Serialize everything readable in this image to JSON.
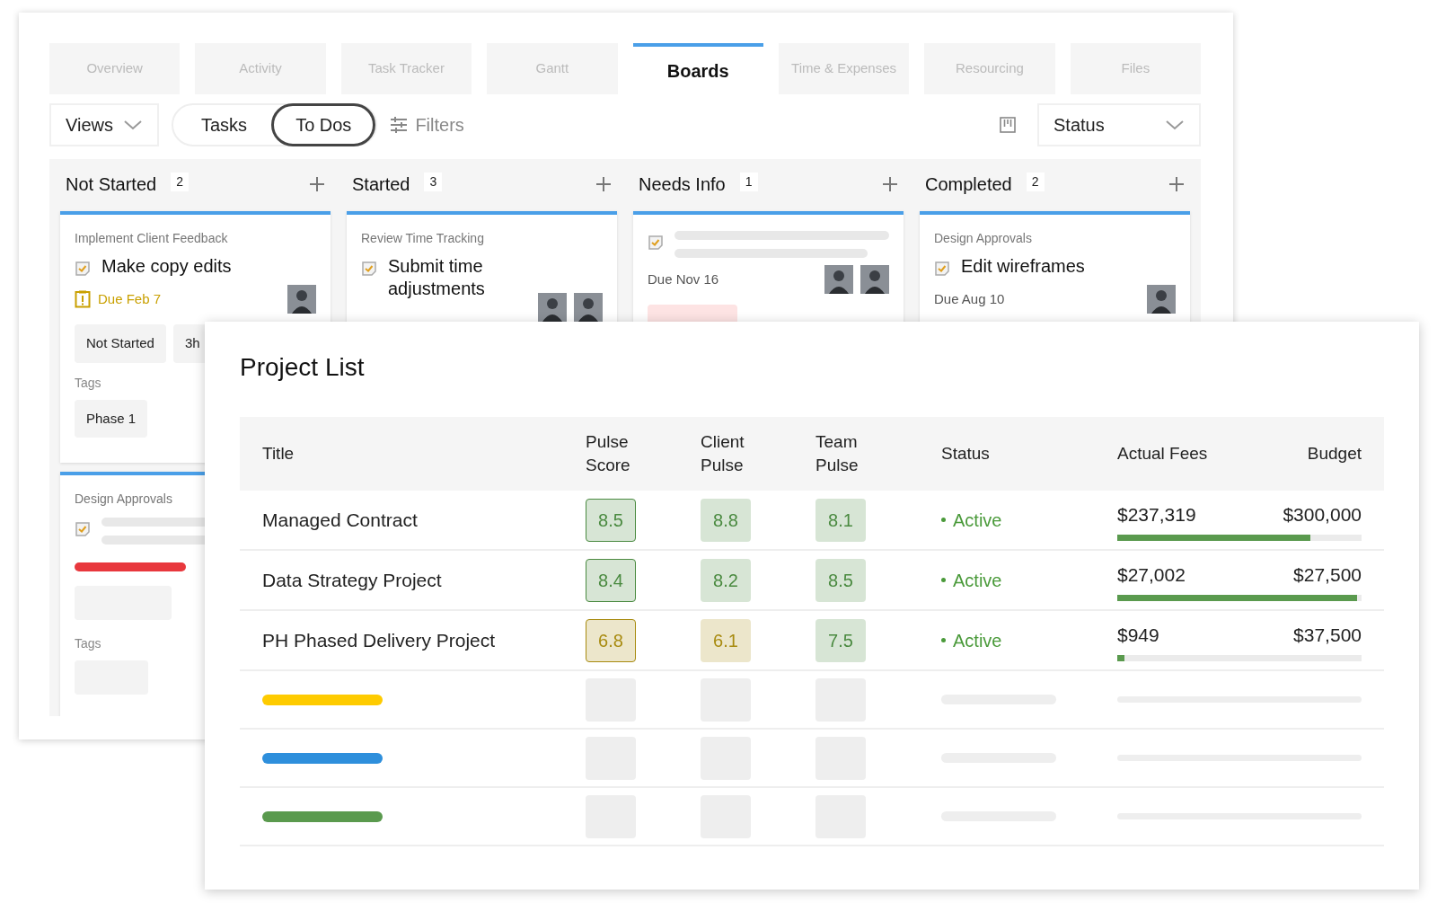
{
  "tabs": [
    {
      "label": "Overview",
      "selected": false
    },
    {
      "label": "Activity",
      "selected": false
    },
    {
      "label": "Task Tracker",
      "selected": false
    },
    {
      "label": "Gantt",
      "selected": false
    },
    {
      "label": "Boards",
      "selected": true
    },
    {
      "label": "Time & Expenses",
      "selected": false
    },
    {
      "label": "Resourcing",
      "selected": false
    },
    {
      "label": "Files",
      "selected": false
    }
  ],
  "toolbar": {
    "views": "Views",
    "segments": [
      {
        "label": "Tasks",
        "selected": false
      },
      {
        "label": "To Dos",
        "selected": true
      }
    ],
    "filters": "Filters",
    "group_by": "Status"
  },
  "board": {
    "columns": [
      {
        "name": "Not Started",
        "count": "2",
        "cards": [
          {
            "kind": "full",
            "project": "Implement Client Feedback",
            "title": "Make copy edits",
            "due": "Due Feb 7",
            "due_warning": true,
            "avatars": [
              {
                "kind": "person"
              }
            ],
            "chips": [
              "Not Started",
              "3h"
            ],
            "tags_label": "Tags",
            "tags": [
              "Phase 1"
            ]
          },
          {
            "kind": "skeleton",
            "project": "Design Approvals",
            "tags_label": "Tags"
          }
        ]
      },
      {
        "name": "Started",
        "count": "3",
        "cards": [
          {
            "kind": "full",
            "project": "Review Time Tracking",
            "title": "Submit time adjustments",
            "avatars": [
              {
                "kind": "person"
              },
              {
                "kind": "person"
              }
            ]
          }
        ]
      },
      {
        "name": "Needs Info",
        "count": "1",
        "cards": [
          {
            "kind": "pending",
            "due": "Due Nov 16",
            "due_warning": false,
            "avatars": [
              {
                "kind": "person"
              },
              {
                "kind": "person"
              }
            ]
          }
        ]
      },
      {
        "name": "Completed",
        "count": "2",
        "cards": [
          {
            "kind": "full",
            "project": "Design Approvals",
            "title": "Edit wireframes",
            "due": "Due Aug 10",
            "due_warning": false,
            "avatars": [
              {
                "kind": "person"
              }
            ]
          }
        ]
      }
    ]
  },
  "project_list": {
    "title": "Project List",
    "columns": [
      "Title",
      "Pulse Score",
      "Client Pulse",
      "Team Pulse",
      "Status",
      "Actual Fees",
      "Budget"
    ],
    "rows": [
      {
        "title": "Managed Contract",
        "scores": [
          {
            "value": "8.5",
            "color": "#4a8a40"
          },
          {
            "value": "8.8",
            "color": "#4a8a40"
          },
          {
            "value": "8.1",
            "color": "#4a8a40"
          }
        ],
        "status": "Active",
        "actual_fees": "$237,319",
        "budget": "$300,000",
        "level": 0.79
      },
      {
        "title": "Data Strategy Project",
        "scores": [
          {
            "value": "8.4",
            "color": "#4a8a40"
          },
          {
            "value": "8.2",
            "color": "#4a8a40"
          },
          {
            "value": "8.5",
            "color": "#4a8a40"
          }
        ],
        "status": "Active",
        "actual_fees": "$27,002",
        "budget": "$27,500",
        "level": 0.98
      },
      {
        "title": "PH Phased Delivery Project",
        "scores": [
          {
            "value": "6.8",
            "color": "#a88b10"
          },
          {
            "value": "6.1",
            "color": "#a88b10"
          },
          {
            "value": "7.5",
            "color": "#4a8a40"
          }
        ],
        "status": "Active",
        "actual_fees": "$949",
        "budget": "$37,500",
        "level": 0.03
      }
    ],
    "placeholder_rows": [
      {
        "color": "#fecb00"
      },
      {
        "color": "#2e8fdc"
      },
      {
        "color": "#5a9a4e"
      }
    ]
  }
}
